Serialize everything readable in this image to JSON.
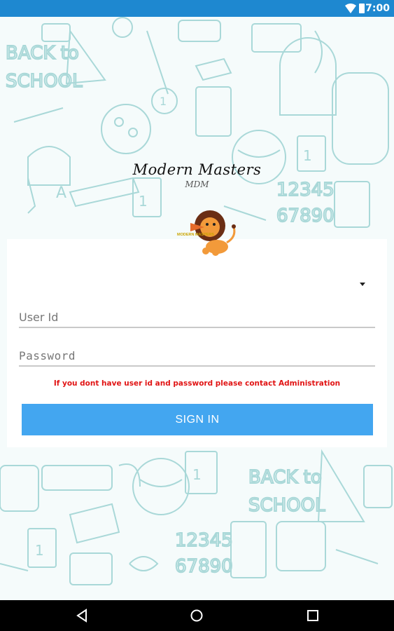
{
  "status_bar": {
    "time": "7:00",
    "icons": [
      "wifi-icon",
      "battery-icon"
    ]
  },
  "brand": {
    "title": "Modern Masters",
    "subtitle": "MDM",
    "logo_text": "MODERN MASTERS"
  },
  "form": {
    "dropdown": {
      "selected": ""
    },
    "userid_placeholder": "User Id",
    "password_placeholder": "Password",
    "notice": "If you dont have user id and password please contact Administration",
    "signin_label": "SIGN IN"
  },
  "nav_bar": {
    "icons": [
      "back-icon",
      "home-icon",
      "recents-icon"
    ]
  },
  "colors": {
    "status_bar": "#1e88d0",
    "accent": "#43a6f0",
    "notice": "#e11414",
    "doodle": "#9fd3d3"
  }
}
